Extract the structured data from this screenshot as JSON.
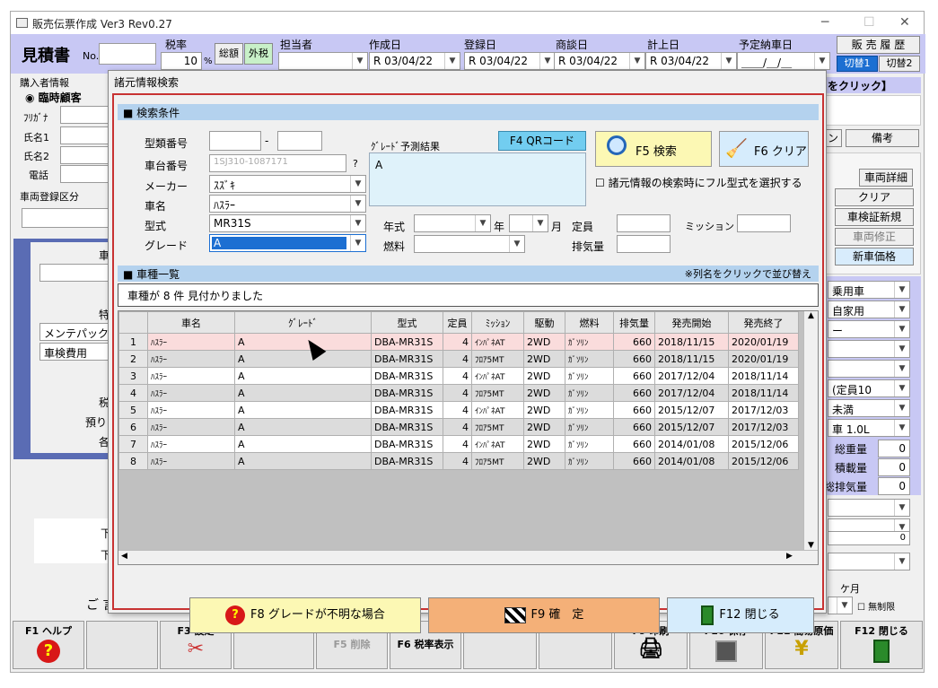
{
  "app": {
    "title": "販売伝票作成 Ver3 Rev0.27",
    "min": "─",
    "max": "☐",
    "close": "✕"
  },
  "header": {
    "doc_title": "見積書",
    "no_label": "No.",
    "tax_rate_label": "税率",
    "tax_rate": "10",
    "pct": "%",
    "sogaku": "総額",
    "gaizei": "外税",
    "tanto_label": "担当者",
    "sakusei_label": "作成日",
    "sakusei": "R 03/04/22",
    "toroku_label": "登録日",
    "toroku": "R 03/04/22",
    "shodan_label": "商談日",
    "shodan": "R 03/04/22",
    "keijo_label": "計上日",
    "keijo": "R 03/04/22",
    "nosha_label": "予定納車日",
    "nosha": "＿＿/＿/＿",
    "hanbai_rireki": "販 売 履 歴",
    "kirikae1": "切替1",
    "kirikae2": "切替2"
  },
  "bg": {
    "konyusha": "購入者情報",
    "rinji": "臨時顧客",
    "furigana": "ﾌﾘｶﾞﾅ",
    "shimei1": "氏名1",
    "shimei2": "氏名2",
    "denwa": "電話",
    "sharyo_kubun": "車両登録区分",
    "click_hint": "をクリック】",
    "n": "ン",
    "biko": "備考",
    "sharyo_shosai": "車両詳細",
    "clear": "クリア",
    "shaken_shinki": "車検証新規",
    "sharyo_shusei": "車両修正",
    "shinsha_kakaku": "新車価格",
    "youyousha": "乗用車",
    "jikayou": "自家用",
    "e": "ー",
    "teiin": "(定員10",
    "miman": "未満",
    "sha_1": "車 1.0L",
    "sojuryo": "総重量",
    "sekisairyo": "積載量",
    "sohaikiryo": "総排気量",
    "zero": "0",
    "getsu": "ケ月",
    "museigen": "無制限",
    "ke": "車",
    "toku": "特",
    "mente": "メンテパック",
    "shaken": "車検費用",
    "zei": "税",
    "azu": "預り",
    "kaku": "各",
    "ka": "下",
    "go": "ご 言"
  },
  "dialog": {
    "title": "諸元情報検索",
    "search_section": "■ 検索条件",
    "ruibetsu_label": "型類番号",
    "dash": "-",
    "shadai_label": "車台番号",
    "shadai": "1SJ310-1087171",
    "q": "?",
    "maker_label": "メーカー",
    "maker": "ｽｽﾞｷ",
    "shamei_label": "車名",
    "shamei": "ﾊｽﾗｰ",
    "katashiki_label": "型式",
    "katashiki": "MR31S",
    "grade_label": "グレード",
    "grade": "A",
    "grade_yosoku_label": "ｸﾞﾚｰﾄﾞ予測結果",
    "grade_yosoku": "A",
    "qr_button": "F4 QRコード",
    "search_button": "F5 検索",
    "clear_button": "F6 クリア",
    "full_katashiki": "諸元情報の検索時にフル型式を選択する",
    "nenshiki_label": "年式",
    "nen": "年",
    "tsuki": "月",
    "teiin_label": "定員",
    "mission_label": "ミッション",
    "nenryo_label": "燃料",
    "haikiryo_label": "排気量",
    "list_section": "■ 車種一覧",
    "sort_hint": "※列名をクリックで並び替え",
    "result": "車種が 8 件 見付かりました",
    "f8": "F8 グレードが不明な場合",
    "f9": "F9 確　定",
    "f12": "F12 閉じる"
  },
  "grid": {
    "columns": [
      "",
      "車名",
      "ｸﾞﾚｰﾄﾞ",
      "型式",
      "定員",
      "ﾐｯｼｮﾝ",
      "駆動",
      "燃料",
      "排気量",
      "発売開始",
      "発売終了"
    ],
    "rows": [
      [
        "1",
        "ﾊｽﾗｰ",
        "A",
        "DBA-MR31S",
        "4",
        "ｲﾝﾊﾟﾈAT",
        "2WD",
        "ｶﾞｿﾘﾝ",
        "660",
        "2018/11/15",
        "2020/01/19"
      ],
      [
        "2",
        "ﾊｽﾗｰ",
        "A",
        "DBA-MR31S",
        "4",
        "ﾌﾛｱ5MT",
        "2WD",
        "ｶﾞｿﾘﾝ",
        "660",
        "2018/11/15",
        "2020/01/19"
      ],
      [
        "3",
        "ﾊｽﾗｰ",
        "A",
        "DBA-MR31S",
        "4",
        "ｲﾝﾊﾟﾈAT",
        "2WD",
        "ｶﾞｿﾘﾝ",
        "660",
        "2017/12/04",
        "2018/11/14"
      ],
      [
        "4",
        "ﾊｽﾗｰ",
        "A",
        "DBA-MR31S",
        "4",
        "ﾌﾛｱ5MT",
        "2WD",
        "ｶﾞｿﾘﾝ",
        "660",
        "2017/12/04",
        "2018/11/14"
      ],
      [
        "5",
        "ﾊｽﾗｰ",
        "A",
        "DBA-MR31S",
        "4",
        "ｲﾝﾊﾟﾈAT",
        "2WD",
        "ｶﾞｿﾘﾝ",
        "660",
        "2015/12/07",
        "2017/12/03"
      ],
      [
        "6",
        "ﾊｽﾗｰ",
        "A",
        "DBA-MR31S",
        "4",
        "ﾌﾛｱ5MT",
        "2WD",
        "ｶﾞｿﾘﾝ",
        "660",
        "2015/12/07",
        "2017/12/03"
      ],
      [
        "7",
        "ﾊｽﾗｰ",
        "A",
        "DBA-MR31S",
        "4",
        "ｲﾝﾊﾟﾈAT",
        "2WD",
        "ｶﾞｿﾘﾝ",
        "660",
        "2014/01/08",
        "2015/12/06"
      ],
      [
        "8",
        "ﾊｽﾗｰ",
        "A",
        "DBA-MR31S",
        "4",
        "ﾌﾛｱ5MT",
        "2WD",
        "ｶﾞｿﾘﾝ",
        "660",
        "2014/01/08",
        "2015/12/06"
      ]
    ]
  },
  "fkeys": {
    "f1": "F1 ヘルプ",
    "f3": "F3 設定",
    "f5": "F5 削除",
    "f6": "F6 税率表示",
    "f9": "F9 印刷",
    "f10": "F10 保存",
    "f11": "F11 簡易原価",
    "f12": "F12 閉じる"
  },
  "colors": {
    "header_bg": "#c8c8f4",
    "section_bg": "#b4d2ee",
    "accent": "#1c6fd2",
    "dialog_border": "#c83232",
    "row_highlight": "#fadcdc"
  }
}
